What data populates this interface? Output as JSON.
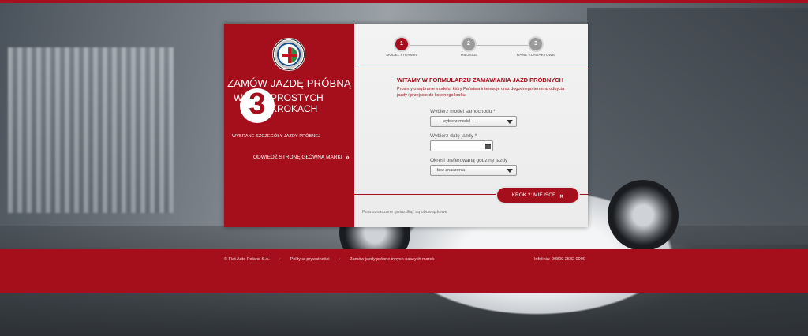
{
  "brand": {
    "accent": "#a40f1b"
  },
  "left_panel": {
    "headline_line1": "ZAMÓW JAZDĘ PRÓBNĄ",
    "headline_w": "W",
    "headline_number": "3",
    "headline_line2": "PROSTYCH KROKACH",
    "selected_details": "WYBRANE SZCZEGÓŁY JAZDY PRÓBNEJ",
    "visit_link": "ODWIEDŹ STRONĘ GŁÓWNĄ MARKI"
  },
  "steps": [
    {
      "number": "1",
      "label": "MODEL I TERMIN",
      "state": "active"
    },
    {
      "number": "2",
      "label": "MIEJSCE",
      "state": "inactive"
    },
    {
      "number": "3",
      "label": "DANE KONTAKTOWE",
      "state": "inactive"
    }
  ],
  "form": {
    "title": "WITAMY W FORMULARZU ZAMAWIANIA JAZD PRÓBNYCH",
    "intro": "Prosimy o wybranie modelu, który Państwa interesuje oraz dogodnego terminu odbycia jazdy i przejście do kolejnego kroku.",
    "model_label": "Wybierz model samochodu *",
    "model_value": "--- wybierz model ---",
    "date_label": "Wybierz datę jazdy *",
    "date_value": "",
    "time_label": "Określ preferowaną godzinę jazdy",
    "time_value": "bez znaczenia",
    "next_button": "KROK 2: MIEJSCE",
    "required_note": "Pola oznaczone gwiazdką* są obowiązkowe"
  },
  "footer": {
    "copyright": "© Fiat Auto Poland S.A.",
    "privacy": "Polityka prywatności",
    "other_brands": "Zamów jazdy próbne innych naszych marek",
    "infolinia": "Infolinia: 00800 2532 0000"
  }
}
